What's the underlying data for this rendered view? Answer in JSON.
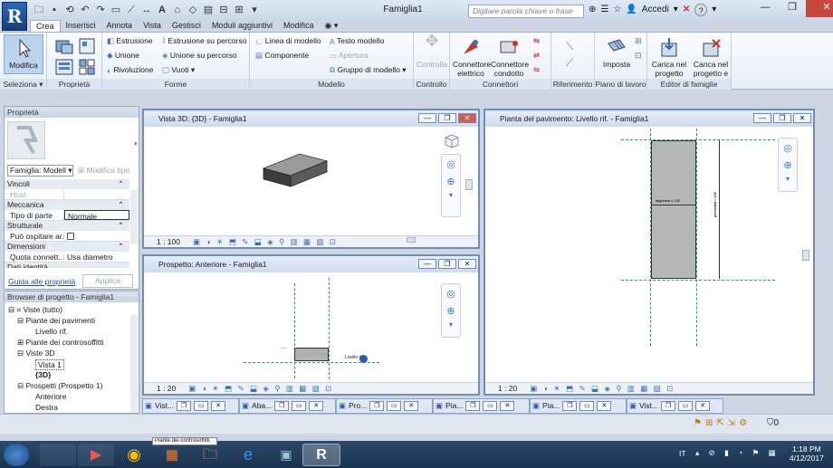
{
  "app": {
    "title": "Famiglia1",
    "logo_letter": "R"
  },
  "search": {
    "placeholder": "Digitare parola chiave o frase"
  },
  "user": {
    "login_label": "Accedi",
    "help": "?"
  },
  "tabs": [
    "Crea",
    "Inserisci",
    "Annota",
    "Vista",
    "Gestisci",
    "Moduli aggiuntivi",
    "Modifica"
  ],
  "ribbon": {
    "modify": "Modifica",
    "seleziona": "Seleziona",
    "proprieta": "Proprietà",
    "forme": {
      "label": "Forme",
      "items": [
        "Estrusione",
        "Unione",
        "Rivoluzione",
        "Estrusione su percorso",
        "Unione su percorso",
        "Vuoti"
      ]
    },
    "modello": {
      "label": "Modello",
      "items": [
        "Linea di modello",
        "Componente",
        "Testo modello",
        "Apertura",
        "Gruppo di modello"
      ]
    },
    "controllo": {
      "label": "Controllo",
      "item": "Controlla"
    },
    "connettori": {
      "label": "Connettori",
      "items": [
        "Connettore elettrico",
        "Connettore condotto"
      ]
    },
    "riferimento": {
      "label": "Riferimento"
    },
    "piano": {
      "label": "Piano di lavoro",
      "item": "Imposta"
    },
    "editor": {
      "label": "Editor di famiglie",
      "items": [
        "Carica nel progetto",
        "Carica nel progetto e chiudi"
      ]
    }
  },
  "properties": {
    "title": "Proprietà",
    "type_selector": "Famiglia: Modell",
    "edit_type": "Modifica tipo",
    "groups": [
      {
        "name": "Vincoli",
        "rows": [
          {
            "k": "Host",
            "v": ""
          }
        ]
      },
      {
        "name": "Meccanica",
        "rows": [
          {
            "k": "Tipo di parte",
            "v": "Normale"
          }
        ]
      },
      {
        "name": "Strutturale",
        "rows": [
          {
            "k": "Può ospitare ar...",
            "v": ""
          }
        ]
      },
      {
        "name": "Dimensioni",
        "rows": [
          {
            "k": "Quota connett...",
            "v": "Usa diametro"
          }
        ]
      },
      {
        "name": "Dati identità",
        "rows": []
      }
    ],
    "help_link": "Guida alle proprietà",
    "apply": "Applica"
  },
  "browser": {
    "title": "Browser di progetto - Famiglia1",
    "items": [
      "Viste (tutto)",
      "Piante dei pavimenti",
      "Livello rif.",
      "Piante dei controsoffitti",
      "Viste 3D",
      "Vista 1",
      "{3D}",
      "Prospetti (Prospetto 1)",
      "Anteriore",
      "Destra"
    ]
  },
  "views": {
    "v3d": {
      "title": "Vista 3D: {3D} - Famiglia1",
      "scale": "1 : 100"
    },
    "front": {
      "title": "Prospetto: Anteriore - Famiglia1",
      "scale": "1 : 20"
    },
    "plan": {
      "title": "Pianta del pavimento: Livello rif. - Famiglia1",
      "scale": "1 : 20",
      "dim_h": "larghezza = 1,00",
      "dim_v": "profondità = 3,00"
    }
  },
  "view_tabs": [
    "Vist...",
    "Aba...",
    "Pro...",
    "Pia...",
    "Pia...",
    "Vist..."
  ],
  "statusbar": {
    "filter": "0"
  },
  "taskbar": {
    "lang": "IT",
    "time": "1:18 PM",
    "date": "4/12/2017",
    "tooltip": "Piante dei controsoffitti"
  }
}
